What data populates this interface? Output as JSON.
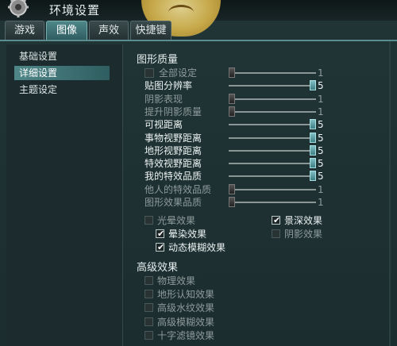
{
  "window": {
    "title": "环境设置"
  },
  "tabs": [
    {
      "label": "游戏",
      "active": false
    },
    {
      "label": "图像",
      "active": true
    },
    {
      "label": "声效",
      "active": false
    },
    {
      "label": "快捷键",
      "active": false
    }
  ],
  "nav": [
    {
      "label": "基础设置",
      "active": false
    },
    {
      "label": "详细设置",
      "active": true
    },
    {
      "label": "主题设定",
      "active": false
    }
  ],
  "graphics_quality": {
    "title": "图形质量",
    "rows": [
      {
        "label": "全部设定",
        "type": "checkbox-slider",
        "enabled": false,
        "value": "1",
        "level": 0.0
      },
      {
        "label": "贴图分辨率",
        "type": "slider",
        "enabled": true,
        "value": "5",
        "level": 1.0
      },
      {
        "label": "阴影表现",
        "type": "slider",
        "enabled": false,
        "value": "1",
        "level": 0.0
      },
      {
        "label": "提升阴影质量",
        "type": "slider",
        "enabled": false,
        "value": "1",
        "level": 0.0
      },
      {
        "label": "可视距离",
        "type": "slider",
        "enabled": true,
        "value": "5",
        "level": 1.0
      },
      {
        "label": "事物视野距离",
        "type": "slider",
        "enabled": true,
        "value": "5",
        "level": 1.0
      },
      {
        "label": "地形视野距离",
        "type": "slider",
        "enabled": true,
        "value": "5",
        "level": 1.0
      },
      {
        "label": "特效视野距离",
        "type": "slider",
        "enabled": true,
        "value": "5",
        "level": 1.0
      },
      {
        "label": "我的特效品质",
        "type": "slider",
        "enabled": true,
        "value": "5",
        "level": 1.0
      },
      {
        "label": "他人的特效品质",
        "type": "slider",
        "enabled": false,
        "value": "1",
        "level": 0.0
      },
      {
        "label": "图形效果品质",
        "type": "slider",
        "enabled": false,
        "value": "1",
        "level": 0.0
      }
    ],
    "effects": [
      {
        "label": "光晕效果",
        "checked": false
      },
      {
        "label": "景深效果",
        "checked": true
      },
      {
        "label": "晕染效果",
        "checked": true
      },
      {
        "label": "阴影效果",
        "checked": false
      },
      {
        "label": "动态模糊效果",
        "checked": true
      }
    ]
  },
  "advanced_effects": {
    "title": "高级效果",
    "items": [
      {
        "label": "物理效果",
        "checked": false
      },
      {
        "label": "地形认知效果",
        "checked": false
      },
      {
        "label": "高级水纹效果",
        "checked": false
      },
      {
        "label": "高级模糊效果",
        "checked": false
      },
      {
        "label": "十字滤镜效果",
        "checked": false
      }
    ]
  },
  "colors": {
    "accent": "#4f8789",
    "background": "#1c2d2f"
  }
}
